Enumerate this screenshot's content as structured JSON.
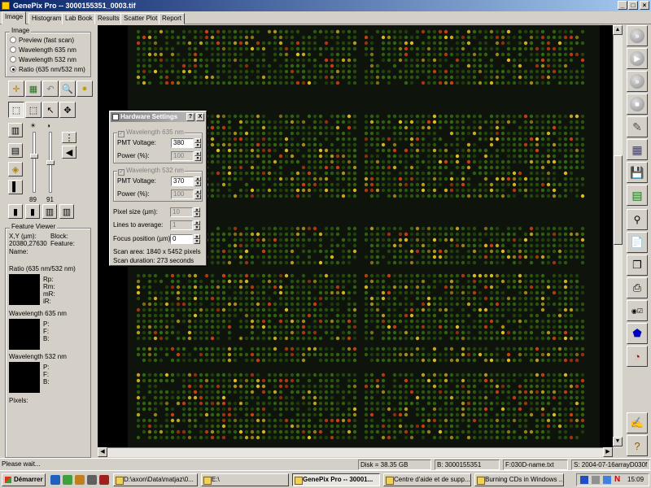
{
  "window": {
    "title": "GenePix Pro -- 3000155351_0003.tif"
  },
  "tabs": [
    {
      "label": "Image",
      "active": true
    },
    {
      "label": "Histogram",
      "active": false
    },
    {
      "label": "Lab Book",
      "active": false
    },
    {
      "label": "Results",
      "active": false
    },
    {
      "label": "Scatter Plot",
      "active": false
    },
    {
      "label": "Report",
      "active": false
    }
  ],
  "image_group": {
    "title": "Image",
    "options": [
      {
        "label": "Preview  (fast scan)",
        "selected": false
      },
      {
        "label": "Wavelength 635 nm",
        "selected": false
      },
      {
        "label": "Wavelength 532 nm",
        "selected": false
      },
      {
        "label": "Ratio (635 nm/532 nm)",
        "selected": true
      }
    ]
  },
  "sliders": {
    "left_value": "89",
    "right_value": "91"
  },
  "feature_viewer": {
    "title": "Feature Viewer",
    "xy_label": "X,Y (µm):",
    "xy_value": "20380,27630",
    "block_label": "Block:",
    "feature_label": "Feature:",
    "name_label": "Name:",
    "ratio_title": "Ratio (635 nm/532 nm)",
    "ratio_fields": [
      "Rp:",
      "Rm:",
      "mR:",
      "iR:"
    ],
    "w635_title": "Wavelength 635 nm",
    "w635_fields": [
      "P:",
      "F:",
      "B:"
    ],
    "w532_title": "Wavelength 532 nm",
    "w532_fields": [
      "P:",
      "F:",
      "B:"
    ],
    "pixels_label": "Pixels:"
  },
  "dialog": {
    "title": "Hardware Settings",
    "help": "?",
    "close": "X",
    "w635": {
      "title": "Wavelength 635 nm",
      "pmt_label": "PMT Voltage:",
      "pmt_value": "380",
      "power_label": "Power (%):",
      "power_value": "100"
    },
    "w532": {
      "title": "Wavelength 532 nm",
      "pmt_label": "PMT Voltage:",
      "pmt_value": "370",
      "power_label": "Power (%):",
      "power_value": "100"
    },
    "pixel_size_label": "Pixel size (µm):",
    "pixel_size_value": "10",
    "lines_label": "Lines to average:",
    "lines_value": "1",
    "focus_label": "Focus position (µm):",
    "focus_value": "0",
    "scan_area": "Scan area: 1840 x 5452 pixels",
    "scan_duration": "Scan duration: 273 seconds"
  },
  "statusbar": {
    "message": "Please wait...",
    "disk": "Disk = 38.35 GB",
    "barcode": "B: 3000155351",
    "file": "F:030D-name.txt",
    "setting": "S: 2004-07-16arrayD030f"
  },
  "taskbar": {
    "start": "Démarrer",
    "tasks": [
      {
        "label": "D:\\axon\\Data\\matjaz\\0...",
        "active": false
      },
      {
        "label": "E:\\",
        "active": false
      },
      {
        "label": "GenePix Pro -- 30001...",
        "active": true
      },
      {
        "label": "Centre d'aide et de supp...",
        "active": false
      },
      {
        "label": "Burning CDs in Windows ...",
        "active": false
      }
    ],
    "clock": "15:09"
  },
  "colors": {
    "title_active": "#0a246a",
    "spot_green": "#3a7a10",
    "spot_yellow": "#e0c020",
    "spot_red": "#d04010",
    "scan_bg": "#0e130c"
  }
}
